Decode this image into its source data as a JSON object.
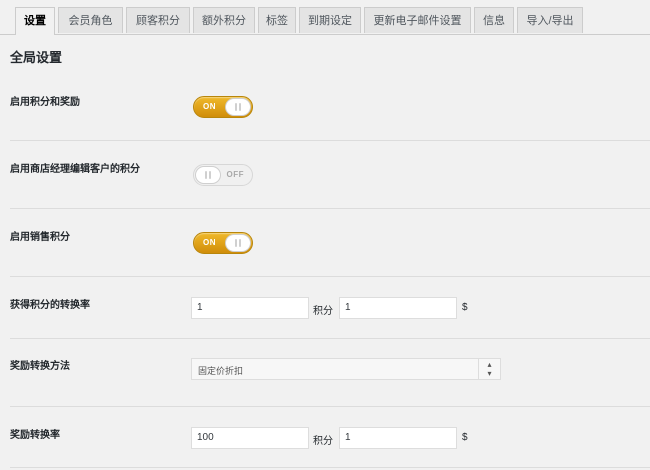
{
  "tabs": [
    "设置",
    "会员角色",
    "顾客积分",
    "额外积分",
    "标签",
    "到期设定",
    "更新电子邮件设置",
    "信息",
    "导入/导出"
  ],
  "section_title": "全局设置",
  "settings": {
    "enable_points": {
      "label": "启用积分和奖励",
      "state": "ON"
    },
    "manager_edit": {
      "label": "启用商店经理编辑客户的积分",
      "state": "OFF"
    },
    "sales_points": {
      "label": "启用销售积分",
      "state": "ON"
    },
    "earn_rate": {
      "label": "获得积分的转换率",
      "points_value": "1",
      "points_unit": "积分",
      "money_value": "1",
      "money_unit": "$"
    },
    "redeem_method": {
      "label": "奖励转换方法",
      "selected": "固定价折扣"
    },
    "redeem_rate": {
      "label": "奖励转换率",
      "points_value": "100",
      "points_unit": "积分",
      "money_value": "1",
      "money_unit": "$"
    }
  },
  "colors": {
    "toggle_on": "#e0a31a",
    "toggle_off": "#f0f0f0",
    "background": "#f1f1f1"
  }
}
